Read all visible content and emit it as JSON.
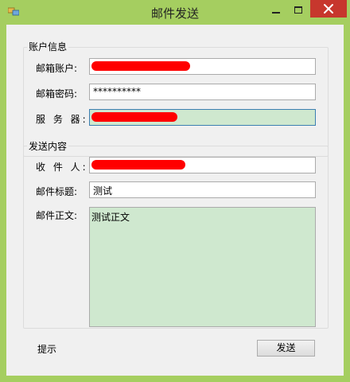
{
  "window": {
    "title": "邮件发送",
    "accent_color": "#a5ce60",
    "close_color": "#c7372d"
  },
  "account_group": {
    "legend": "账户信息",
    "email_label": "邮箱账户:",
    "email_value": "",
    "password_label": "邮箱密码:",
    "password_value": "**********",
    "server_label": "服 务 器:",
    "server_value": ""
  },
  "send_group": {
    "legend": "发送内容",
    "recipient_label": "收 件 人:",
    "recipient_value": "",
    "subject_label": "邮件标题:",
    "subject_value": "测试",
    "body_label": "邮件正文:",
    "body_value": "测试正文"
  },
  "footer": {
    "hint_label": "提示",
    "send_button": "发送"
  },
  "icons": {
    "app": "app-icon",
    "minimize": "minimize-icon",
    "maximize": "maximize-icon",
    "close": "close-icon"
  }
}
